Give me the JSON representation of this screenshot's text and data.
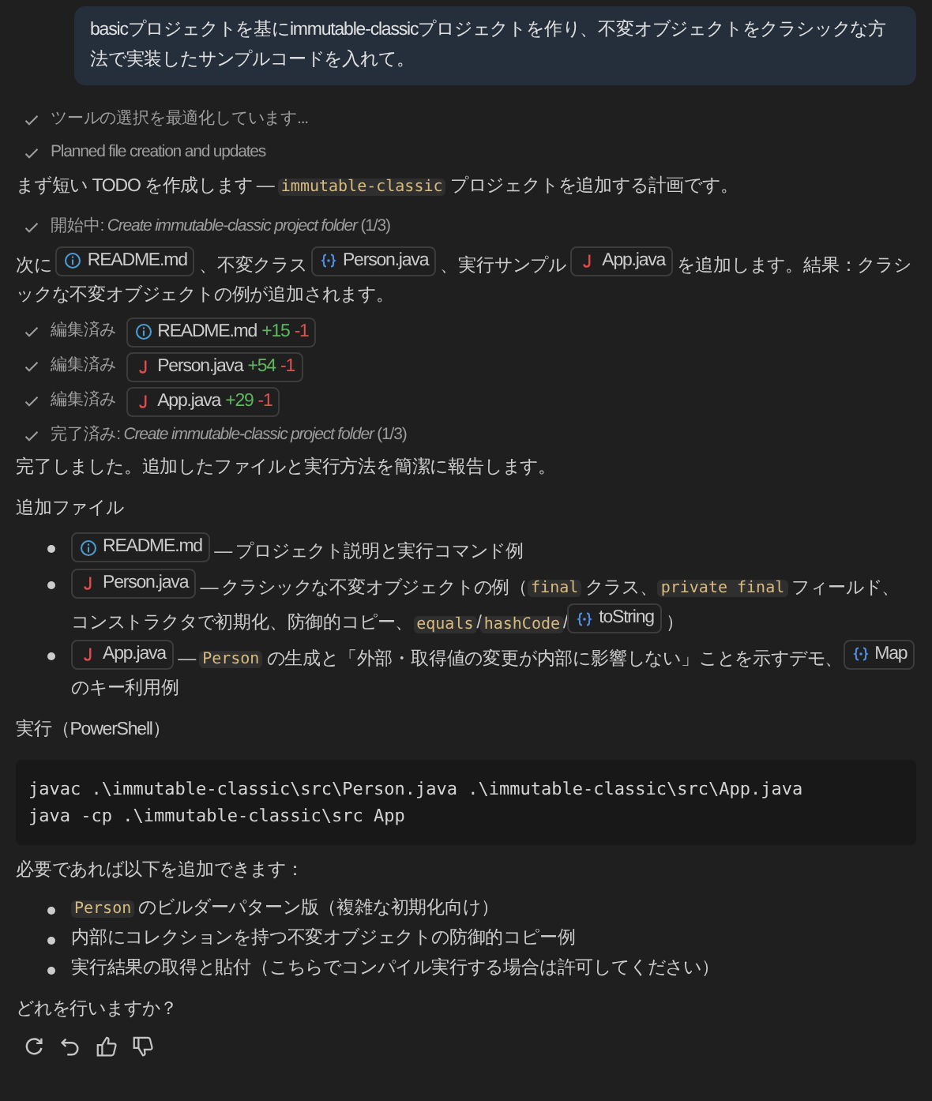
{
  "user_message": "basicプロジェクトを基にimmutable-classicプロジェクトを作り、不変オブジェクトをクラシックな方法で実装したサンプルコードを入れて。",
  "blocks": [
    {
      "kind": "status",
      "text": "ツールの選択を最適化しています..."
    },
    {
      "kind": "status",
      "text": "Planned file creation and updates"
    },
    {
      "kind": "para",
      "segments": [
        {
          "kind": "text",
          "text": "まず短い TODO を作成します — "
        },
        {
          "kind": "code",
          "text": "immutable-classic"
        },
        {
          "kind": "text",
          "text": " プロジェクトを追加する計画です。"
        }
      ]
    },
    {
      "kind": "status",
      "text": "開始中: *Create immutable-classic project folder* (1/3)"
    },
    {
      "kind": "para",
      "segments": [
        {
          "kind": "text",
          "text": "次に "
        },
        {
          "kind": "info_file",
          "text": "README.md"
        },
        {
          "kind": "text",
          "text": " 、不変クラス "
        },
        {
          "kind": "symbol",
          "text": "Person.java"
        },
        {
          "kind": "text",
          "text": " 、実行サンプル "
        },
        {
          "kind": "java_file",
          "text": "App.java"
        },
        {
          "kind": "text",
          "text": " を追加します。結果：クラシックな不変オブジェクトの例が追加されます。"
        }
      ]
    },
    {
      "kind": "edit",
      "label": "編集済み",
      "file": {
        "kind": "info_file",
        "text": "README.md"
      },
      "added": "+15",
      "removed": "-1"
    },
    {
      "kind": "edit",
      "label": "編集済み",
      "file": {
        "kind": "java_file",
        "text": "Person.java"
      },
      "added": "+54",
      "removed": "-1"
    },
    {
      "kind": "edit",
      "label": "編集済み",
      "file": {
        "kind": "java_file",
        "text": "App.java"
      },
      "added": "+29",
      "removed": "-1"
    },
    {
      "kind": "status",
      "text": "完了済み: *Create immutable-classic project folder* (1/3)"
    },
    {
      "kind": "para",
      "segments": [
        {
          "kind": "text",
          "text": "完了しました。追加したファイルと実行方法を簡潔に報告します。"
        }
      ]
    },
    {
      "kind": "para",
      "segments": [
        {
          "kind": "text",
          "text": "追加ファイル"
        }
      ]
    },
    {
      "kind": "bullets",
      "items": [
        [
          {
            "kind": "info_file",
            "text": "README.md"
          },
          {
            "kind": "text",
            "text": " — プロジェクト説明と実行コマンド例"
          }
        ],
        [
          {
            "kind": "java_file",
            "text": "Person.java"
          },
          {
            "kind": "text",
            "text": " — クラシックな不変オブジェクトの例（"
          },
          {
            "kind": "code",
            "text": "final"
          },
          {
            "kind": "text",
            "text": " クラス、"
          },
          {
            "kind": "code",
            "text": "private final"
          },
          {
            "kind": "text",
            "text": " フィールド、コンストラクタで初期化、防御的コピー、"
          },
          {
            "kind": "code",
            "text": "equals"
          },
          {
            "kind": "text",
            "text": "/"
          },
          {
            "kind": "code",
            "text": "hashCode"
          },
          {
            "kind": "text",
            "text": "/"
          },
          {
            "kind": "symbol",
            "text": "toString"
          },
          {
            "kind": "text",
            "text": " ）"
          }
        ],
        [
          {
            "kind": "java_file",
            "text": "App.java"
          },
          {
            "kind": "text",
            "text": " — "
          },
          {
            "kind": "code",
            "text": "Person"
          },
          {
            "kind": "text",
            "text": " の生成と「外部・取得値の変更が内部に影響しない」ことを示すデモ、"
          },
          {
            "kind": "symbol",
            "text": "Map"
          },
          {
            "kind": "text",
            "text": " のキー利用例"
          }
        ]
      ]
    },
    {
      "kind": "para",
      "segments": [
        {
          "kind": "text",
          "text": "実行（PowerShell）"
        }
      ]
    },
    {
      "kind": "codeblock",
      "lines": [
        "javac .\\immutable-classic\\src\\Person.java .\\immutable-classic\\src\\App.java",
        "java -cp .\\immutable-classic\\src App"
      ]
    },
    {
      "kind": "para",
      "segments": [
        {
          "kind": "text",
          "text": "必要であれば以下を追加できます："
        }
      ]
    },
    {
      "kind": "bullets",
      "items": [
        [
          {
            "kind": "code",
            "text": "Person"
          },
          {
            "kind": "text",
            "text": " のビルダーパターン版（複雑な初期化向け）"
          }
        ],
        [
          {
            "kind": "text",
            "text": "内部にコレクションを持つ不変オブジェクトの防御的コピー例"
          }
        ],
        [
          {
            "kind": "text",
            "text": "実行結果の取得と貼付（こちらでコンパイル実行する場合は許可してください）"
          }
        ]
      ]
    },
    {
      "kind": "para",
      "segments": [
        {
          "kind": "text",
          "text": "どれを行いますか？"
        }
      ]
    }
  ]
}
